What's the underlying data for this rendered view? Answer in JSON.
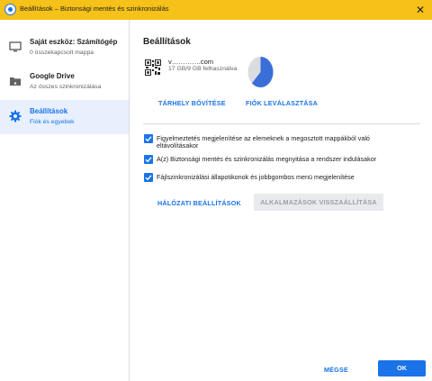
{
  "window": {
    "title": "Beállítások – Biztonsági mentés és szinkronizálás",
    "close_glyph": "✕"
  },
  "sidebar": {
    "items": [
      {
        "title": "Saját eszköz: Számítógép",
        "subtitle": "0 összekapcsolt mappa",
        "icon": "monitor-icon",
        "active": false
      },
      {
        "title": "Google Drive",
        "subtitle": "Az összes szinkronizálása",
        "icon": "drive-folder-icon",
        "active": false
      },
      {
        "title": "Beállítások",
        "subtitle": "Fiók és egyebek",
        "icon": "gear-icon",
        "active": true
      }
    ]
  },
  "settings": {
    "title": "Beállítások",
    "account": {
      "email": "v………….com",
      "storage": "17 GB/9 GB felhasználva",
      "storage_used_fraction": 0.62
    },
    "links": {
      "upgrade_storage": "TÁRHELY BŐVÍTÉSE",
      "disconnect_account": "FIÓK LEVÁLASZTÁSA"
    },
    "options": [
      {
        "label": "Figyelmeztetés megjelenítése az elemeknek a megosztott mappákból való eltávolításakor",
        "checked": true
      },
      {
        "label": "A(z) Biztonsági mentés és szinkronizálás megnyitása a rendszer indulásakor",
        "checked": true
      },
      {
        "label": "Fájlszinkronizálási állapotikonok és jobbgombos menü megjelenítése",
        "checked": true
      }
    ],
    "network_settings": "HÁLÓZATI BEÁLLÍTÁSOK",
    "reset_apps": "ALKALMAZÁSOK VISSZAÁLLÍTÁSA"
  },
  "footer": {
    "cancel": "MÉGSE",
    "ok": "OK"
  },
  "colors": {
    "titlebar": "#f6c118",
    "accent": "#1a73e8",
    "active_nav_bg": "#e8f0fe"
  }
}
